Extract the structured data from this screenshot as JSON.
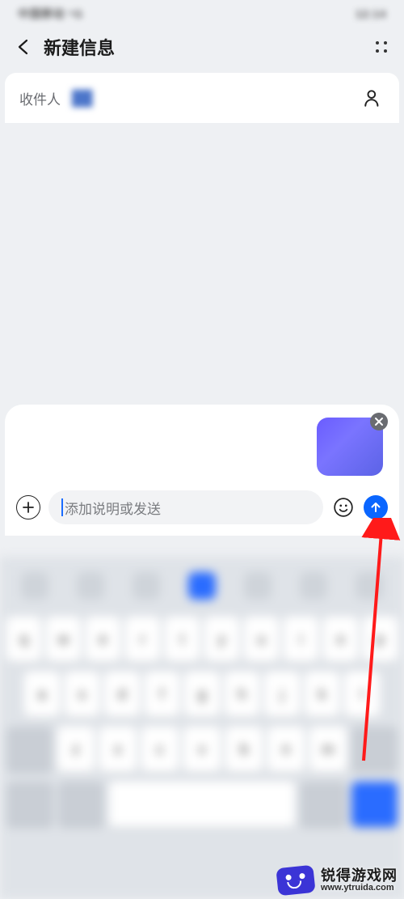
{
  "status": {
    "left": "中国移动 ⁵G",
    "right": "12:14"
  },
  "header": {
    "title": "新建信息"
  },
  "recipient": {
    "label": "收件人",
    "value": "██"
  },
  "compose": {
    "placeholder": "添加说明或发送"
  },
  "keyboard": {
    "row1": [
      "q",
      "w",
      "e",
      "r",
      "t",
      "y",
      "u",
      "i",
      "o",
      "p"
    ],
    "row2": [
      "a",
      "s",
      "d",
      "f",
      "g",
      "h",
      "j",
      "k",
      "l"
    ],
    "row3": [
      "z",
      "x",
      "c",
      "v",
      "b",
      "n",
      "m"
    ]
  },
  "watermark": {
    "name": "锐得游戏网",
    "url": "www.ytruida.com"
  },
  "colors": {
    "accent": "#0a66ff"
  }
}
